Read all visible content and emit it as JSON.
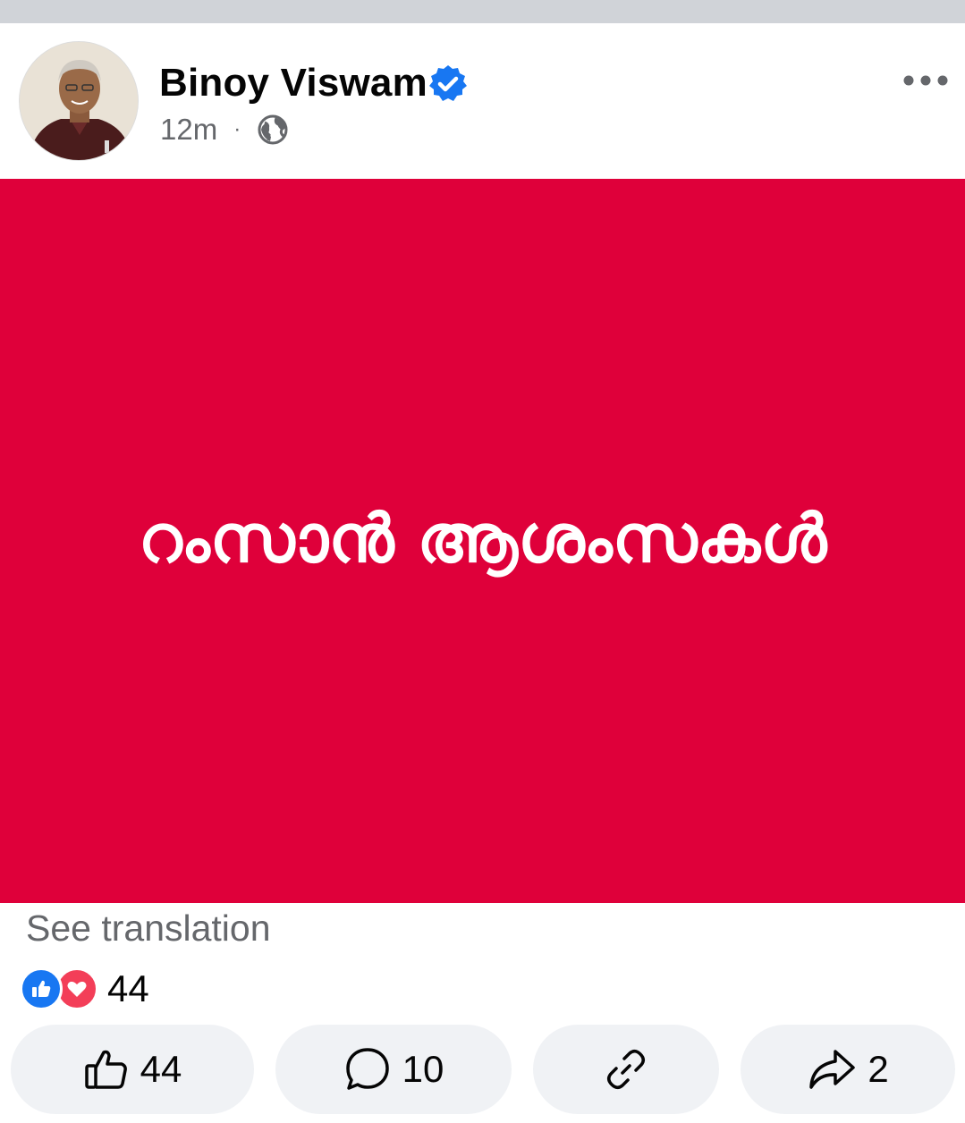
{
  "post": {
    "author": "Binoy Viswam",
    "time": "12m",
    "separator": "·",
    "audience_icon": "globe-icon",
    "verified_icon": "verified-badge-icon",
    "more_icon": "more-options-icon",
    "image_text": "റംസാൻ ആശംസകൾ",
    "see_translation": "See translation"
  },
  "reactions": {
    "types": [
      "like",
      "love"
    ],
    "count": "44"
  },
  "actions": {
    "like_count": "44",
    "comment_count": "10",
    "share_count": "2"
  },
  "colors": {
    "post_background": "#df003a",
    "accent_blue": "#1877f2",
    "love_red": "#f33e58",
    "secondary_text": "#65676b",
    "button_bg": "#f0f2f5"
  }
}
